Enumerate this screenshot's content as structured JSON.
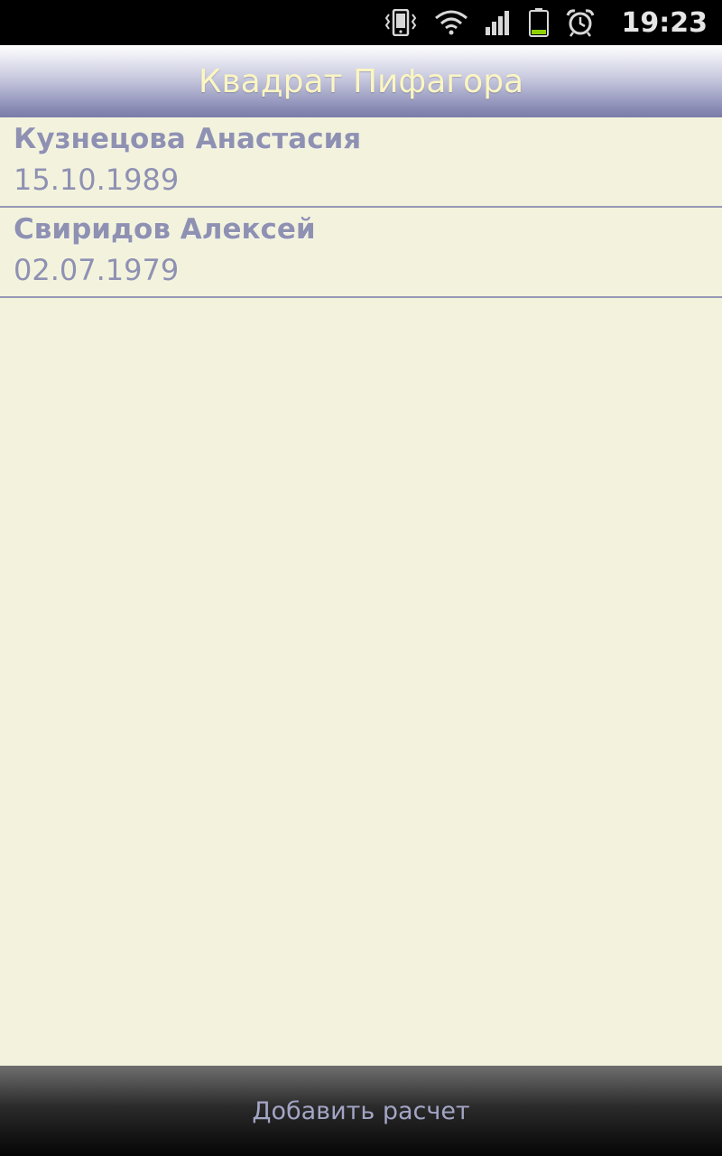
{
  "status_bar": {
    "time": "19:23",
    "icons": [
      "vibrate-icon",
      "wifi-icon",
      "signal-icon",
      "battery-icon",
      "alarm-icon"
    ]
  },
  "app": {
    "title": "Квадрат Пифагора"
  },
  "list": {
    "items": [
      {
        "name": "Кузнецова Анастасия",
        "date": "15.10.1989"
      },
      {
        "name": "Свиридов Алексей",
        "date": "02.07.1979"
      }
    ]
  },
  "bottom_bar": {
    "add_label": "Добавить расчет"
  },
  "colors": {
    "background": "#f3f3dd",
    "title_text": "#fbf6c2",
    "item_text": "#8f91b3",
    "divider": "#9698b6",
    "battery_level": "#8ed100"
  }
}
